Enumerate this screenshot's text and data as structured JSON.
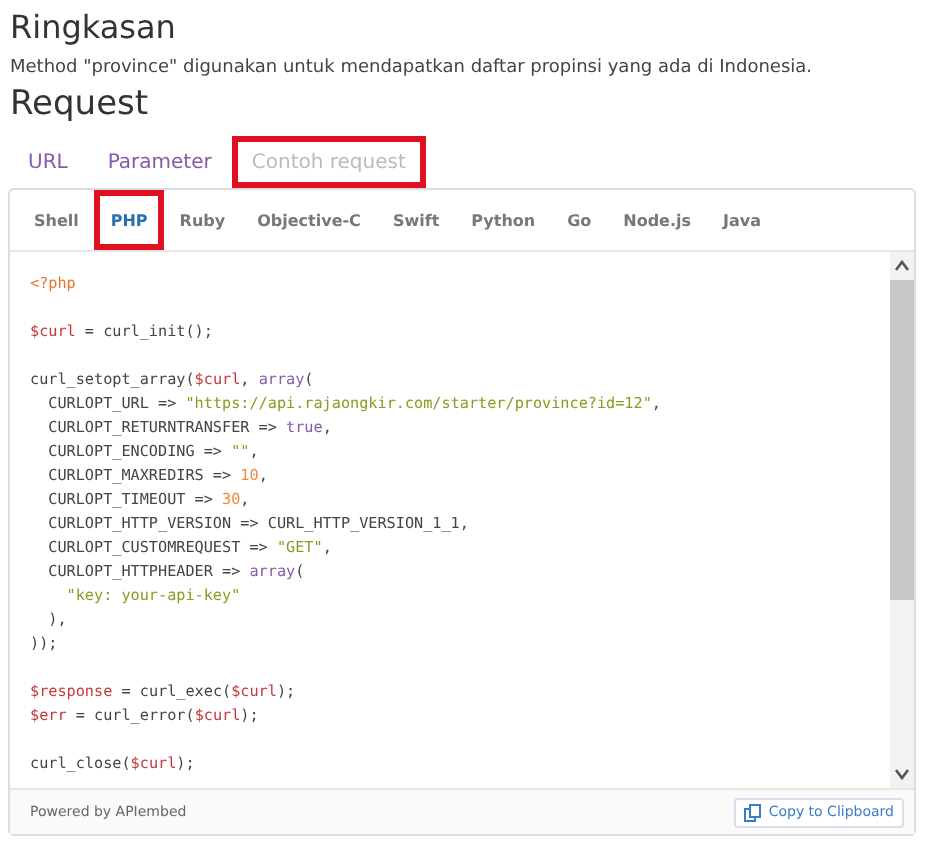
{
  "summary": {
    "title": "Ringkasan",
    "description": "Method \"province\" digunakan untuk mendapatkan daftar propinsi yang ada di Indonesia."
  },
  "request": {
    "title": "Request",
    "tabs": [
      {
        "label": "URL",
        "selected": false,
        "highlighted": false
      },
      {
        "label": "Parameter",
        "selected": false,
        "highlighted": false
      },
      {
        "label": "Contoh request",
        "selected": true,
        "highlighted": true
      }
    ],
    "languages": [
      {
        "label": "Shell",
        "selected": false,
        "highlighted": false
      },
      {
        "label": "PHP",
        "selected": true,
        "highlighted": true
      },
      {
        "label": "Ruby",
        "selected": false,
        "highlighted": false
      },
      {
        "label": "Objective-C",
        "selected": false,
        "highlighted": false
      },
      {
        "label": "Swift",
        "selected": false,
        "highlighted": false
      },
      {
        "label": "Python",
        "selected": false,
        "highlighted": false
      },
      {
        "label": "Go",
        "selected": false,
        "highlighted": false
      },
      {
        "label": "Node.js",
        "selected": false,
        "highlighted": false
      },
      {
        "label": "Java",
        "selected": false,
        "highlighted": false
      }
    ],
    "code": [
      {
        "gap_before": false,
        "tokens": [
          {
            "kind": "tag",
            "text": "<?php"
          }
        ]
      },
      {
        "gap_before": true,
        "tokens": [
          {
            "kind": "var",
            "text": "$curl"
          },
          {
            "kind": "plain",
            "text": " = curl_init();"
          }
        ]
      },
      {
        "gap_before": true,
        "tokens": [
          {
            "kind": "plain",
            "text": "curl_setopt_array("
          },
          {
            "kind": "var",
            "text": "$curl"
          },
          {
            "kind": "plain",
            "text": ", "
          },
          {
            "kind": "kw",
            "text": "array"
          },
          {
            "kind": "plain",
            "text": "("
          }
        ]
      },
      {
        "gap_before": false,
        "tokens": [
          {
            "kind": "plain",
            "text": "  CURLOPT_URL => "
          },
          {
            "kind": "str",
            "text": "\"https://api.rajaongkir.com/starter/province?id=12\""
          },
          {
            "kind": "plain",
            "text": ","
          }
        ]
      },
      {
        "gap_before": false,
        "tokens": [
          {
            "kind": "plain",
            "text": "  CURLOPT_RETURNTRANSFER => "
          },
          {
            "kind": "kw",
            "text": "true"
          },
          {
            "kind": "plain",
            "text": ","
          }
        ]
      },
      {
        "gap_before": false,
        "tokens": [
          {
            "kind": "plain",
            "text": "  CURLOPT_ENCODING => "
          },
          {
            "kind": "str",
            "text": "\"\""
          },
          {
            "kind": "plain",
            "text": ","
          }
        ]
      },
      {
        "gap_before": false,
        "tokens": [
          {
            "kind": "plain",
            "text": "  CURLOPT_MAXREDIRS => "
          },
          {
            "kind": "num",
            "text": "10"
          },
          {
            "kind": "plain",
            "text": ","
          }
        ]
      },
      {
        "gap_before": false,
        "tokens": [
          {
            "kind": "plain",
            "text": "  CURLOPT_TIMEOUT => "
          },
          {
            "kind": "num",
            "text": "30"
          },
          {
            "kind": "plain",
            "text": ","
          }
        ]
      },
      {
        "gap_before": false,
        "tokens": [
          {
            "kind": "plain",
            "text": "  CURLOPT_HTTP_VERSION => CURL_HTTP_VERSION_1_1,"
          }
        ]
      },
      {
        "gap_before": false,
        "tokens": [
          {
            "kind": "plain",
            "text": "  CURLOPT_CUSTOMREQUEST => "
          },
          {
            "kind": "str",
            "text": "\"GET\""
          },
          {
            "kind": "plain",
            "text": ","
          }
        ]
      },
      {
        "gap_before": false,
        "tokens": [
          {
            "kind": "plain",
            "text": "  CURLOPT_HTTPHEADER => "
          },
          {
            "kind": "kw",
            "text": "array"
          },
          {
            "kind": "plain",
            "text": "("
          }
        ]
      },
      {
        "gap_before": false,
        "tokens": [
          {
            "kind": "str",
            "text": "    \"key: your-api-key\""
          }
        ]
      },
      {
        "gap_before": false,
        "tokens": [
          {
            "kind": "plain",
            "text": "  ),"
          }
        ]
      },
      {
        "gap_before": false,
        "tokens": [
          {
            "kind": "plain",
            "text": "));"
          }
        ]
      },
      {
        "gap_before": true,
        "tokens": [
          {
            "kind": "var",
            "text": "$response"
          },
          {
            "kind": "plain",
            "text": " = curl_exec("
          },
          {
            "kind": "var",
            "text": "$curl"
          },
          {
            "kind": "plain",
            "text": ");"
          }
        ]
      },
      {
        "gap_before": false,
        "tokens": [
          {
            "kind": "var",
            "text": "$err"
          },
          {
            "kind": "plain",
            "text": " = curl_error("
          },
          {
            "kind": "var",
            "text": "$curl"
          },
          {
            "kind": "plain",
            "text": ");"
          }
        ]
      },
      {
        "gap_before": true,
        "tokens": [
          {
            "kind": "plain",
            "text": "curl_close("
          },
          {
            "kind": "var",
            "text": "$curl"
          },
          {
            "kind": "plain",
            "text": ");"
          }
        ]
      }
    ],
    "footer": {
      "credit": "Powered by APIembed",
      "copy_button": "Copy to Clipboard"
    }
  }
}
